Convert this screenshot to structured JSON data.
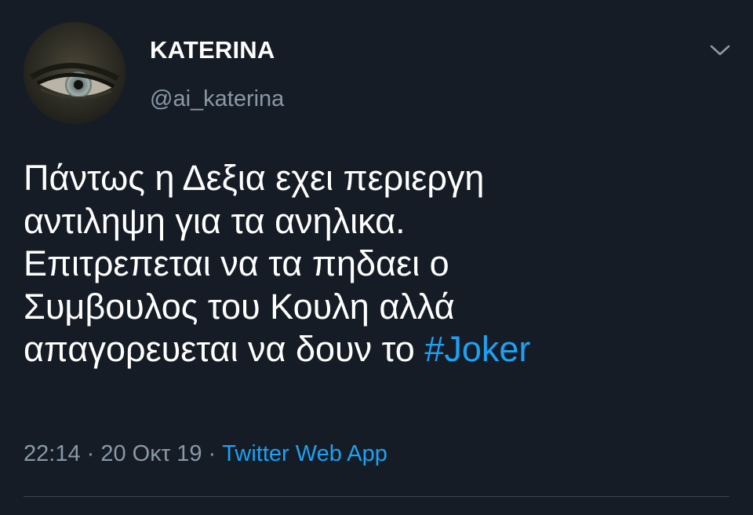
{
  "theme": {
    "background": "#161c26",
    "text_primary": "#ffffff",
    "text_secondary": "#8899a6",
    "link": "#1da1f2",
    "divider": "#38444d"
  },
  "tweet": {
    "author": {
      "display_name": "KATERINA",
      "handle": "@ai_katerina",
      "avatar_icon": "eye-avatar"
    },
    "menu_icon": "chevron-down-icon",
    "text": "Πάντως η Δεξια εχει περιεργη\nαντιληψη για τα ανηλικα.\nΕπιτρεπεται να τα πηδαει ο\nΣυμβουλος του Κουλη αλλά\nαπαγορευεται να δουν το ",
    "hashtag": "#Joker",
    "time": "22:14",
    "separator": " · ",
    "date": "20 Οκτ 19",
    "source": "Twitter Web App"
  }
}
